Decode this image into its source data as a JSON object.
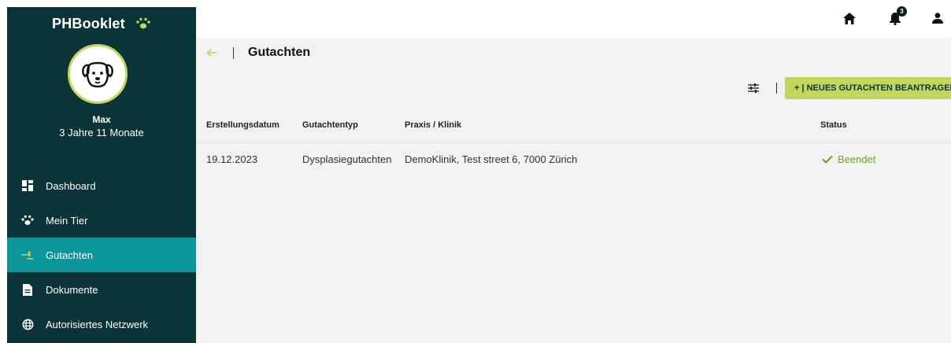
{
  "app": {
    "logo_text": "PHBooklet",
    "logo_icon": "paw-icon"
  },
  "pet": {
    "name": "Max",
    "age": "3 Jahre 11 Monate",
    "avatar_icon": "dog-face-icon"
  },
  "sidebar": {
    "items": [
      {
        "label": "Dashboard",
        "icon": "dashboard-icon",
        "active": false
      },
      {
        "label": "Mein Tier",
        "icon": "paw-icon",
        "active": false
      },
      {
        "label": "Gutachten",
        "icon": "gavel-icon",
        "active": true
      },
      {
        "label": "Dokumente",
        "icon": "document-icon",
        "active": false
      },
      {
        "label": "Autorisiertes Netzwerk",
        "icon": "globe-icon",
        "active": false
      }
    ]
  },
  "topbar": {
    "home_icon": "home-icon",
    "notifications_icon": "bell-icon",
    "notification_count": "3",
    "user_icon": "user-icon"
  },
  "page": {
    "back_icon": "arrow-left-icon",
    "title": "Gutachten",
    "filter_icon": "filter-sliders-icon",
    "new_button_label": "+ | NEUES GUTACHTEN BEANTRAGEN"
  },
  "table": {
    "columns": [
      "Erstellungsdatum",
      "Gutachtentyp",
      "Praxis / Klinik",
      "Status"
    ],
    "rows": [
      {
        "date": "19.12.2023",
        "type": "Dysplasiegutachten",
        "clinic": "DemoKlinik, Test street 6, 7000 Zürich",
        "status": "Beendet",
        "status_icon": "check-icon"
      }
    ]
  },
  "colors": {
    "sidebar_bg": "#0b3438",
    "active_item": "#0b969c",
    "accent_lime": "#c2d65c",
    "status_green": "#6aa531",
    "content_bg": "#f2f2f2"
  }
}
